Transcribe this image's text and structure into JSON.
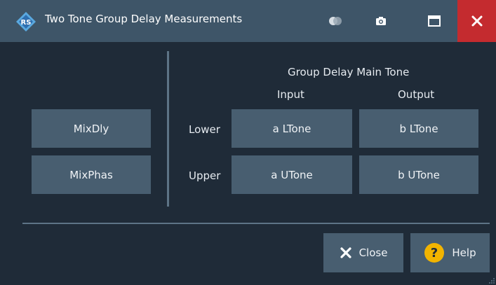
{
  "window": {
    "title": "Two Tone Group Delay Measurements"
  },
  "left_buttons": {
    "mixdly": "MixDly",
    "mixphas": "MixPhas"
  },
  "group": {
    "heading": "Group Delay Main Tone",
    "col_input": "Input",
    "col_output": "Output",
    "row_lower": "Lower",
    "row_upper": "Upper",
    "a_ltone": "a LTone",
    "b_ltone": "b LTone",
    "a_utone": "a UTone",
    "b_utone": "b UTone"
  },
  "footer": {
    "close_label": "Close",
    "help_label": "Help"
  },
  "colors": {
    "title_bar": "#3e5568",
    "background": "#1f2b38",
    "button": "#485e70",
    "close_red": "#c42b2f",
    "help_yellow": "#f2b400"
  },
  "icons": {
    "app": "rs-logo-icon",
    "toggle": "toggle-icon",
    "camera": "camera-icon",
    "maximize": "maximize-icon",
    "close": "close-icon",
    "footer_close": "x-icon",
    "help": "question-icon"
  }
}
